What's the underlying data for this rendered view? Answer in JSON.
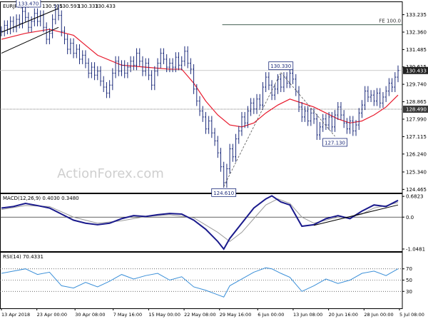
{
  "chart_data": {
    "type": "line",
    "header": {
      "symbol": "EURJPY,H4",
      "ohlc": [
        "130.505",
        "130.593",
        "130.333",
        "130.433"
      ]
    },
    "watermark": "ActionForex.com",
    "price_panel": {
      "ylim": [
        124.3,
        133.9
      ],
      "y_ticks": [
        "133.235",
        "132.360",
        "131.485",
        "130.615",
        "129.740",
        "128.865",
        "127.990",
        "127.115",
        "126.240",
        "125.340",
        "124.465"
      ],
      "current_price": {
        "value": 130.433,
        "label": "130.433"
      },
      "support_level": {
        "value": 128.49,
        "label": "128.490"
      },
      "fe_level": {
        "value": 132.73,
        "label": "FE 100.0",
        "x_start": 73.5
      },
      "close_series": [
        [
          0,
          132.4
        ],
        [
          1,
          132.7
        ],
        [
          2,
          132.5
        ],
        [
          3,
          132.9
        ],
        [
          4,
          132.6
        ],
        [
          5,
          133.0
        ],
        [
          6,
          132.8
        ],
        [
          7,
          133.4
        ],
        [
          8,
          133.1
        ],
        [
          9,
          132.6
        ],
        [
          10,
          132.9
        ],
        [
          11,
          133.3
        ],
        [
          12,
          132.9
        ],
        [
          13,
          133.2
        ],
        [
          14,
          132.6
        ],
        [
          15,
          132.0
        ],
        [
          16,
          132.3
        ],
        [
          17,
          133.0
        ],
        [
          18,
          133.5
        ],
        [
          19,
          133.2
        ],
        [
          20,
          132.4
        ],
        [
          21,
          132.0
        ],
        [
          22,
          131.5
        ],
        [
          23,
          131.8
        ],
        [
          24,
          131.3
        ],
        [
          25,
          131.5
        ],
        [
          26,
          131.0
        ],
        [
          27,
          131.2
        ],
        [
          28,
          130.8
        ],
        [
          29,
          130.3
        ],
        [
          30,
          130.6
        ],
        [
          31,
          130.2
        ],
        [
          32,
          130.4
        ],
        [
          33,
          129.9
        ],
        [
          34,
          129.6
        ],
        [
          35,
          129.3
        ],
        [
          36,
          129.7
        ],
        [
          37,
          130.3
        ],
        [
          38,
          130.9
        ],
        [
          39,
          130.4
        ],
        [
          40,
          130.7
        ],
        [
          41,
          130.3
        ],
        [
          42,
          130.6
        ],
        [
          43,
          130.9
        ],
        [
          44,
          130.7
        ],
        [
          45,
          131.3
        ],
        [
          46,
          130.9
        ],
        [
          47,
          130.4
        ],
        [
          48,
          130.8
        ],
        [
          49,
          130.2
        ],
        [
          50,
          129.7
        ],
        [
          51,
          130.4
        ],
        [
          52,
          130.8
        ],
        [
          53,
          131.3
        ],
        [
          54,
          131.0
        ],
        [
          55,
          130.6
        ],
        [
          56,
          130.8
        ],
        [
          57,
          130.6
        ],
        [
          58,
          131.1
        ],
        [
          59,
          130.7
        ],
        [
          60,
          130.9
        ],
        [
          61,
          131.4
        ],
        [
          62,
          130.8
        ],
        [
          63,
          130.5
        ],
        [
          64,
          129.5
        ],
        [
          65,
          128.9
        ],
        [
          66,
          128.4
        ],
        [
          67,
          128.1
        ],
        [
          68,
          127.5
        ],
        [
          69,
          127.9
        ],
        [
          70,
          127.3
        ],
        [
          71,
          126.9
        ],
        [
          72,
          126.3
        ],
        [
          73,
          125.6
        ],
        [
          74,
          124.8
        ],
        [
          75,
          125.5
        ],
        [
          76,
          126.5
        ],
        [
          77,
          126.1
        ],
        [
          78,
          127.0
        ],
        [
          79,
          127.4
        ],
        [
          80,
          128.1
        ],
        [
          81,
          127.8
        ],
        [
          82,
          128.4
        ],
        [
          83,
          128.8
        ],
        [
          84,
          128.5
        ],
        [
          85,
          129.0
        ],
        [
          86,
          128.7
        ],
        [
          87,
          129.6
        ],
        [
          88,
          130.1
        ],
        [
          89,
          129.7
        ],
        [
          90,
          129.2
        ],
        [
          91,
          129.5
        ],
        [
          92,
          130.0
        ],
        [
          93,
          129.6
        ],
        [
          94,
          130.1
        ],
        [
          95,
          129.8
        ],
        [
          96,
          130.3
        ],
        [
          97,
          130.0
        ],
        [
          98,
          129.4
        ],
        [
          99,
          128.6
        ],
        [
          100,
          128.1
        ],
        [
          101,
          128.4
        ],
        [
          102,
          127.9
        ],
        [
          103,
          128.3
        ],
        [
          104,
          128.0
        ],
        [
          105,
          127.2
        ],
        [
          106,
          127.6
        ],
        [
          107,
          128.0
        ],
        [
          108,
          127.7
        ],
        [
          109,
          128.1
        ],
        [
          110,
          127.6
        ],
        [
          111,
          128.2
        ],
        [
          112,
          128.6
        ],
        [
          113,
          128.2
        ],
        [
          114,
          127.8
        ],
        [
          115,
          127.5
        ],
        [
          116,
          127.9
        ],
        [
          117,
          127.4
        ],
        [
          118,
          127.7
        ],
        [
          119,
          128.3
        ],
        [
          120,
          128.7
        ],
        [
          121,
          129.4
        ],
        [
          122,
          129.1
        ],
        [
          123,
          129.2
        ],
        [
          124,
          128.9
        ],
        [
          125,
          129.3
        ],
        [
          126,
          128.8
        ],
        [
          127,
          129.1
        ],
        [
          128,
          129.4
        ],
        [
          129,
          129.8
        ],
        [
          130,
          129.6
        ],
        [
          131,
          130.1
        ],
        [
          132,
          130.433
        ]
      ],
      "ma_series": [
        [
          0,
          132.0
        ],
        [
          8,
          132.3
        ],
        [
          16,
          132.5
        ],
        [
          24,
          132.2
        ],
        [
          32,
          131.2
        ],
        [
          40,
          130.7
        ],
        [
          48,
          130.6
        ],
        [
          56,
          130.5
        ],
        [
          60,
          130.5
        ],
        [
          64,
          129.8
        ],
        [
          68,
          128.9
        ],
        [
          72,
          128.2
        ],
        [
          76,
          127.7
        ],
        [
          80,
          127.6
        ],
        [
          84,
          127.8
        ],
        [
          88,
          128.3
        ],
        [
          92,
          128.7
        ],
        [
          96,
          129.0
        ],
        [
          100,
          128.8
        ],
        [
          104,
          128.6
        ],
        [
          108,
          128.3
        ],
        [
          112,
          128.0
        ],
        [
          116,
          127.8
        ],
        [
          120,
          127.9
        ],
        [
          124,
          128.2
        ],
        [
          128,
          128.6
        ],
        [
          132,
          129.2
        ]
      ],
      "swing_labels": [
        {
          "x": 9,
          "y": 133.47,
          "label": "133.470",
          "pos": "above"
        },
        {
          "x": 74,
          "y": 124.61,
          "label": "124.610",
          "pos": "below"
        },
        {
          "x": 93,
          "y": 130.33,
          "label": "130.330",
          "pos": "above"
        },
        {
          "x": 111,
          "y": 127.13,
          "label": "127.130",
          "pos": "below"
        }
      ],
      "trendlines": [
        {
          "from": [
            0,
            131.3
          ],
          "to": [
            19,
            132.6
          ],
          "style": "solid"
        },
        {
          "from": [
            0,
            132.35
          ],
          "to": [
            19,
            133.55
          ],
          "style": "solid"
        },
        {
          "from": [
            74,
            124.61
          ],
          "to": [
            93,
            130.33
          ],
          "style": "dashed"
        },
        {
          "from": [
            93,
            130.33
          ],
          "to": [
            111,
            127.13
          ],
          "style": "dashed"
        }
      ]
    },
    "macd_panel": {
      "title": "MACD(12,26,9) 0.4030 0.3480",
      "ylim": [
        -1.12,
        0.78
      ],
      "ticks": [
        {
          "value": 0.6823,
          "label": "0.6823"
        },
        {
          "value": 0,
          "label": "0.0"
        },
        {
          "value": -1.0481,
          "label": "-1.0481"
        }
      ],
      "macd_series": [
        [
          0,
          0.3
        ],
        [
          4,
          0.35
        ],
        [
          8,
          0.45
        ],
        [
          12,
          0.38
        ],
        [
          16,
          0.3
        ],
        [
          20,
          0.1
        ],
        [
          24,
          -0.1
        ],
        [
          28,
          -0.2
        ],
        [
          32,
          -0.25
        ],
        [
          36,
          -0.2
        ],
        [
          40,
          -0.05
        ],
        [
          44,
          0.05
        ],
        [
          48,
          0.02
        ],
        [
          52,
          0.08
        ],
        [
          56,
          0.12
        ],
        [
          60,
          0.1
        ],
        [
          64,
          -0.1
        ],
        [
          68,
          -0.4
        ],
        [
          72,
          -0.8
        ],
        [
          74,
          -1.05
        ],
        [
          76,
          -0.7
        ],
        [
          80,
          -0.2
        ],
        [
          84,
          0.3
        ],
        [
          88,
          0.6
        ],
        [
          90,
          0.7
        ],
        [
          93,
          0.5
        ],
        [
          96,
          0.4
        ],
        [
          100,
          -0.3
        ],
        [
          104,
          -0.25
        ],
        [
          108,
          -0.05
        ],
        [
          112,
          0.05
        ],
        [
          116,
          -0.05
        ],
        [
          120,
          0.2
        ],
        [
          124,
          0.4
        ],
        [
          128,
          0.35
        ],
        [
          132,
          0.55
        ]
      ],
      "signal_series": [
        [
          0,
          0.25
        ],
        [
          8,
          0.38
        ],
        [
          16,
          0.35
        ],
        [
          24,
          0.0
        ],
        [
          32,
          -0.2
        ],
        [
          40,
          -0.12
        ],
        [
          48,
          0.02
        ],
        [
          56,
          0.08
        ],
        [
          64,
          -0.02
        ],
        [
          72,
          -0.5
        ],
        [
          76,
          -0.8
        ],
        [
          80,
          -0.5
        ],
        [
          84,
          -0.05
        ],
        [
          88,
          0.4
        ],
        [
          92,
          0.6
        ],
        [
          96,
          0.45
        ],
        [
          100,
          0.0
        ],
        [
          104,
          -0.2
        ],
        [
          108,
          -0.1
        ],
        [
          112,
          0.0
        ],
        [
          116,
          0.0
        ],
        [
          120,
          0.1
        ],
        [
          124,
          0.3
        ],
        [
          128,
          0.38
        ],
        [
          132,
          0.48
        ]
      ],
      "trendline": {
        "from": [
          104,
          -0.27
        ],
        "to": [
          132,
          0.4
        ]
      }
    },
    "rsi_panel": {
      "title": "RSI(14) 70.4331",
      "ylim": [
        0,
        100
      ],
      "ticks": [
        70,
        50,
        30
      ],
      "series": [
        [
          0,
          62
        ],
        [
          4,
          66
        ],
        [
          8,
          70
        ],
        [
          12,
          60
        ],
        [
          16,
          64
        ],
        [
          20,
          40
        ],
        [
          24,
          36
        ],
        [
          28,
          46
        ],
        [
          32,
          38
        ],
        [
          36,
          48
        ],
        [
          40,
          60
        ],
        [
          44,
          52
        ],
        [
          48,
          58
        ],
        [
          52,
          62
        ],
        [
          56,
          50
        ],
        [
          60,
          56
        ],
        [
          64,
          38
        ],
        [
          68,
          32
        ],
        [
          72,
          24
        ],
        [
          74,
          20
        ],
        [
          76,
          40
        ],
        [
          80,
          52
        ],
        [
          84,
          64
        ],
        [
          88,
          72
        ],
        [
          90,
          70
        ],
        [
          93,
          62
        ],
        [
          96,
          55
        ],
        [
          100,
          30
        ],
        [
          104,
          40
        ],
        [
          108,
          52
        ],
        [
          112,
          44
        ],
        [
          116,
          50
        ],
        [
          120,
          62
        ],
        [
          124,
          66
        ],
        [
          128,
          58
        ],
        [
          132,
          70
        ]
      ]
    },
    "x_axis": {
      "n_bars": 133,
      "labels": [
        {
          "x": 1,
          "label": "13 Apr 2018"
        },
        {
          "x": 14,
          "label": "23 Apr 00:00"
        },
        {
          "x": 28,
          "label": "30 Apr 08:00"
        },
        {
          "x": 42,
          "label": "7 May 16:00"
        },
        {
          "x": 55,
          "label": "15 May 00:00"
        },
        {
          "x": 68,
          "label": "22 May 08:00"
        },
        {
          "x": 81,
          "label": "29 May 16:00"
        },
        {
          "x": 95,
          "label": "6 Jun 00:00"
        },
        {
          "x": 108,
          "label": "13 Jun 08:00"
        },
        {
          "x": 121,
          "label": "20 Jun 16:00"
        },
        {
          "x": 134,
          "label": "28 Jun 00:00"
        },
        {
          "x": 147,
          "label": "5 Jul 08:00"
        }
      ]
    },
    "colors": {
      "price": "#1b2a7a",
      "ma": "#e8192c",
      "macd": "#1a1a8c",
      "signal": "#9a9a9a",
      "rsi": "#3a8fd8",
      "grid": "#555555",
      "trend": "#000000",
      "label_bg": "#ffffff",
      "label_border": "#1b2a7a"
    }
  }
}
